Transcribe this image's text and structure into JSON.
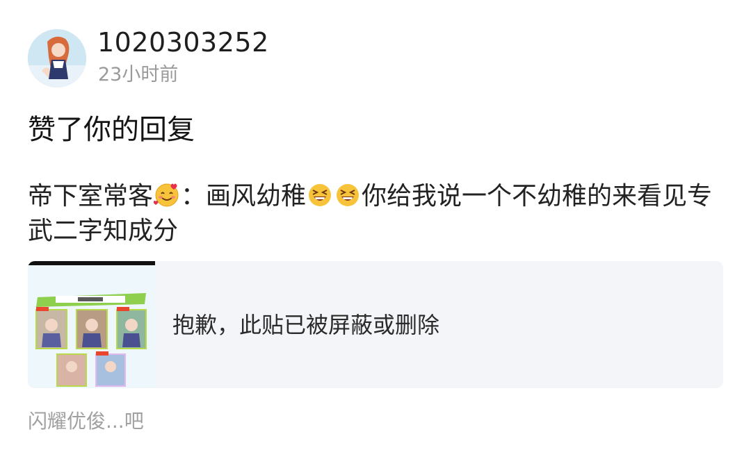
{
  "notification": {
    "username": "1020303252",
    "time": "23小时前",
    "action": "赞了你的回复",
    "avatar_icon": "anime-avatar-icon"
  },
  "quote": {
    "author": "帝下室常客",
    "author_emoji": "smiling-face-with-hearts-emoji",
    "separator": "：",
    "text_part1": "画风幼稚",
    "laugh_emoji": "grinning-squinting-face-emoji",
    "text_part2": "你给我说一个不幼稚的来看见专武二字知成分"
  },
  "card": {
    "message": "抱歉，此贴已被屏蔽或删除",
    "thumbnail_icon": "gacha-result-thumbnail"
  },
  "source": {
    "text": "闪耀优俊...吧"
  },
  "colors": {
    "primary_text": "#1a1a1a",
    "secondary_text": "#9a9a9a",
    "card_bg": "#f4f5f9"
  }
}
